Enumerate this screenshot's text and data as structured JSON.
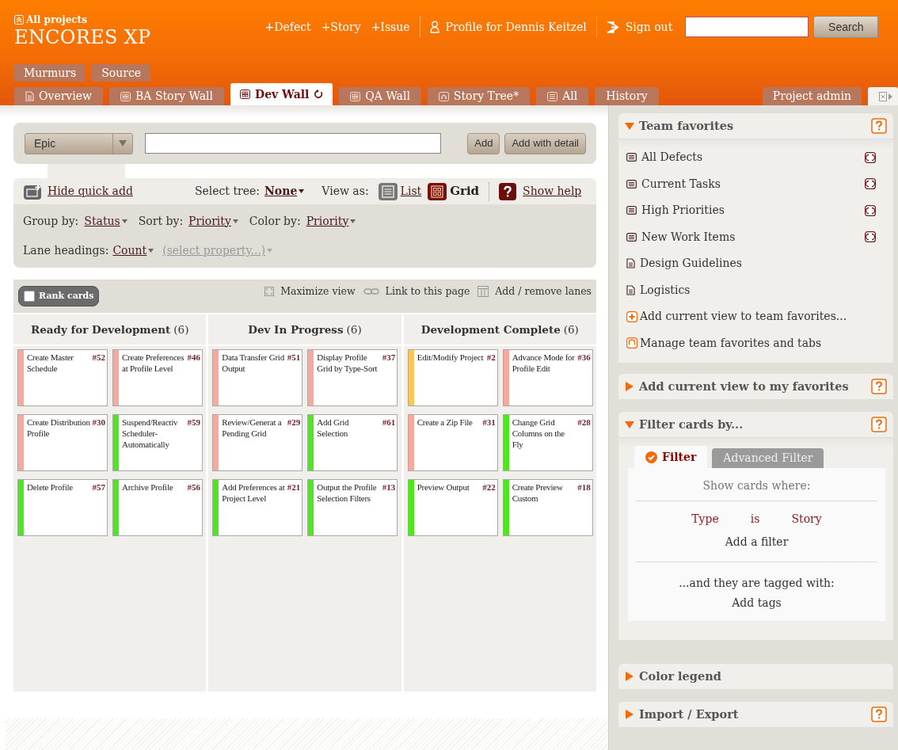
{
  "header": {
    "all_projects": "All projects",
    "project": "ENCORES XP",
    "create_links": [
      "+Defect",
      "+Story",
      "+Issue"
    ],
    "profile": "Profile for Dennis Keitzel",
    "sign_out": "Sign out",
    "search_button": "Search"
  },
  "secondary_tabs": [
    {
      "label": "Murmurs"
    },
    {
      "label": "Source"
    }
  ],
  "tabs": [
    {
      "label": "Overview",
      "kind": "page",
      "selected": false
    },
    {
      "label": "BA Story Wall",
      "kind": "grid",
      "selected": false
    },
    {
      "label": "Dev Wall",
      "kind": "grid",
      "selected": true
    },
    {
      "label": "QA Wall",
      "kind": "grid",
      "selected": false
    },
    {
      "label": "Story Tree*",
      "kind": "tree",
      "selected": false
    },
    {
      "label": "All",
      "kind": "list",
      "selected": false
    },
    {
      "label": "History",
      "kind": "text",
      "selected": false
    }
  ],
  "admin_tab": "Project admin",
  "quick_add": {
    "type": "Epic",
    "buttons": [
      "Add",
      "Add with detail"
    ]
  },
  "toolbar": {
    "hide_quick_add": "Hide quick add",
    "select_tree_label": "Select tree:",
    "select_tree": "None",
    "view_as_label": "View as:",
    "views": [
      {
        "label": "List",
        "kind": "list",
        "selected": false
      },
      {
        "label": "Grid",
        "kind": "grid",
        "selected": true
      }
    ],
    "show_help": "Show help"
  },
  "settings": [
    {
      "label": "Group by:",
      "value": "Status"
    },
    {
      "label": "Sort by:",
      "value": "Priority"
    },
    {
      "label": "Color by:",
      "value": "Priority"
    }
  ],
  "lane_headings": {
    "label": "Lane headings:",
    "value": "Count",
    "property": "(select property...)"
  },
  "wall_bar": {
    "rank_cards": {
      "label": "Rank cards",
      "checked": false
    },
    "links": [
      {
        "label": "Maximize view",
        "kind": "maximize"
      },
      {
        "label": "Link to this page",
        "kind": "link"
      },
      {
        "label": "Add / remove lanes",
        "kind": "lanes"
      }
    ]
  },
  "lanes": [
    {
      "title": "Ready for Development",
      "count": "(6)",
      "cards": [
        {
          "title": "Create Master Schedule",
          "number": "#52",
          "color": "#f9a99b"
        },
        {
          "title": "Create Preferences at Profile Level",
          "number": "#46",
          "color": "#f9a99b"
        },
        {
          "title": "Create Distribution Profile",
          "number": "#30",
          "color": "#f9a99b"
        },
        {
          "title": "Suspend/Reactiv Scheduler-Automatically",
          "number": "#59",
          "color": "#4de81c"
        },
        {
          "title": "Delete Profile",
          "number": "#57",
          "color": "#4de81c"
        },
        {
          "title": "Archive Profile",
          "number": "#56",
          "color": "#4de81c"
        }
      ]
    },
    {
      "title": "Dev In Progress",
      "count": "(6)",
      "cards": [
        {
          "title": "Data Transfer Grid Output",
          "number": "#51",
          "color": "#f9a99b"
        },
        {
          "title": "Display Profile Grid by Type-Sort",
          "number": "#37",
          "color": "#f9a99b"
        },
        {
          "title": "Review/Generat a Pending Grid",
          "number": "#29",
          "color": "#f9a99b"
        },
        {
          "title": "Add Grid Selection",
          "number": "#61",
          "color": "#4de81c"
        },
        {
          "title": "Add Preferences at Project Level",
          "number": "#21",
          "color": "#4de81c"
        },
        {
          "title": "Output the Profile Selection Filters",
          "number": "#13",
          "color": "#4de81c"
        }
      ]
    },
    {
      "title": "Development Complete",
      "count": "(6)",
      "cards": [
        {
          "title": "Edit/Modify Project",
          "number": "#2",
          "color": "#fcc55a"
        },
        {
          "title": "Advance Mode for Profile Edit",
          "number": "#36",
          "color": "#f9a99b"
        },
        {
          "title": "Create a Zip File",
          "number": "#31",
          "color": "#f9a99b"
        },
        {
          "title": "Change Grid Columns on the Fly",
          "number": "#28",
          "color": "#4de81c"
        },
        {
          "title": "Preview Output",
          "number": "#22",
          "color": "#4de81c"
        },
        {
          "title": "Create Preview Custom",
          "number": "#18",
          "color": "#4de81c"
        }
      ]
    }
  ],
  "team_favorites": {
    "title": "Team favorites",
    "expanded": true,
    "help": true,
    "items": [
      {
        "label": "All Defects",
        "kind": "view",
        "refresh": true
      },
      {
        "label": "Current Tasks",
        "kind": "view",
        "refresh": true
      },
      {
        "label": "High Priorities",
        "kind": "view",
        "refresh": true
      },
      {
        "label": "New Work Items",
        "kind": "view",
        "refresh": true
      },
      {
        "label": "Design Guidelines",
        "kind": "page",
        "refresh": false
      },
      {
        "label": "Logistics",
        "kind": "page",
        "refresh": false
      }
    ],
    "actions": [
      {
        "label": "Add current view to team favorites...",
        "kind": "add"
      },
      {
        "label": "Manage team favorites and tabs",
        "kind": "manage"
      }
    ]
  },
  "my_favorites": {
    "title": "Add current view to my favorites",
    "expanded": false,
    "help": true
  },
  "filter_panel": {
    "title": "Filter cards by...",
    "expanded": true,
    "help": true,
    "tabs": [
      {
        "label": "Filter",
        "selected": true
      },
      {
        "label": "Advanced Filter",
        "selected": false
      }
    ],
    "show_where": "Show cards where:",
    "conditions": [
      {
        "property": "Type",
        "operator": "is",
        "value": "Story"
      }
    ],
    "add_filter": "Add a filter",
    "tagged_with": "...and they are tagged with:",
    "add_tags": "Add tags"
  },
  "color_legend": {
    "title": "Color legend",
    "expanded": false,
    "help": false
  },
  "import_export": {
    "title": "Import / Export",
    "expanded": false,
    "help": true
  }
}
